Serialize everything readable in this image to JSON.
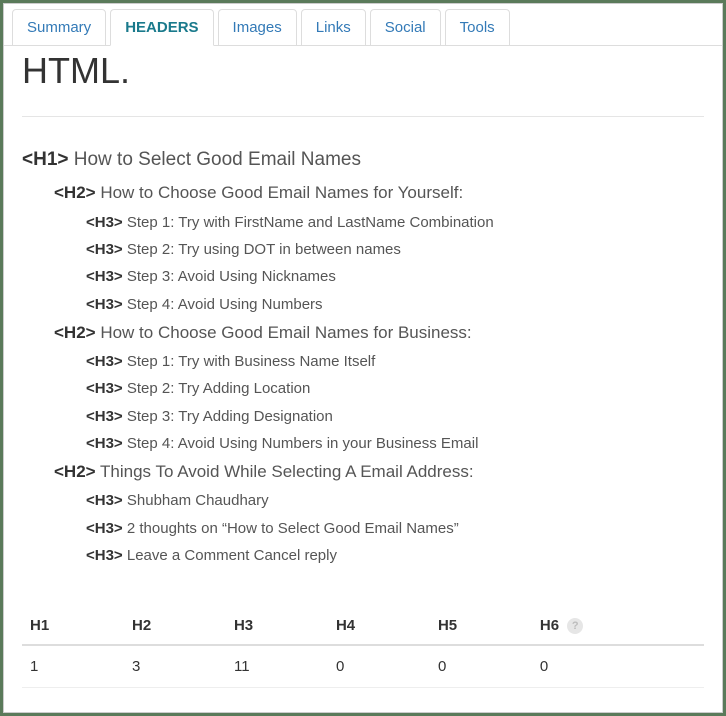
{
  "tabs": [
    {
      "label": "Summary",
      "active": false
    },
    {
      "label": "HEADERS",
      "active": true
    },
    {
      "label": "Images",
      "active": false
    },
    {
      "label": "Links",
      "active": false
    },
    {
      "label": "Social",
      "active": false
    },
    {
      "label": "Tools",
      "active": false
    }
  ],
  "headline": "HTML.",
  "outline": [
    {
      "level": 1,
      "tag": "<H1>",
      "text": "How to Select Good Email Names"
    },
    {
      "level": 2,
      "tag": "<H2>",
      "text": "How to Choose Good Email Names for Yourself:"
    },
    {
      "level": 3,
      "tag": "<H3>",
      "text": "Step 1: Try with FirstName and LastName Combination"
    },
    {
      "level": 3,
      "tag": "<H3>",
      "text": "Step 2: Try using DOT in between names"
    },
    {
      "level": 3,
      "tag": "<H3>",
      "text": "Step 3: Avoid Using Nicknames"
    },
    {
      "level": 3,
      "tag": "<H3>",
      "text": "Step 4: Avoid Using Numbers"
    },
    {
      "level": 2,
      "tag": "<H2>",
      "text": "How to Choose Good Email Names for Business:"
    },
    {
      "level": 3,
      "tag": "<H3>",
      "text": "Step 1: Try with Business Name Itself"
    },
    {
      "level": 3,
      "tag": "<H3>",
      "text": "Step 2: Try Adding Location"
    },
    {
      "level": 3,
      "tag": "<H3>",
      "text": "Step 3: Try Adding Designation"
    },
    {
      "level": 3,
      "tag": "<H3>",
      "text": "Step 4: Avoid Using Numbers in your Business Email"
    },
    {
      "level": 2,
      "tag": "<H2>",
      "text": "Things To Avoid While Selecting A Email Address:"
    },
    {
      "level": 3,
      "tag": "<H3>",
      "text": "Shubham Chaudhary"
    },
    {
      "level": 3,
      "tag": "<H3>",
      "text": "2 thoughts on “How to Select Good Email Names”"
    },
    {
      "level": 3,
      "tag": "<H3>",
      "text": "Leave a Comment Cancel reply"
    }
  ],
  "counts": {
    "headers": [
      "H1",
      "H2",
      "H3",
      "H4",
      "H5",
      "H6"
    ],
    "values": [
      "1",
      "3",
      "11",
      "0",
      "0",
      "0"
    ]
  },
  "help_symbol": "?"
}
